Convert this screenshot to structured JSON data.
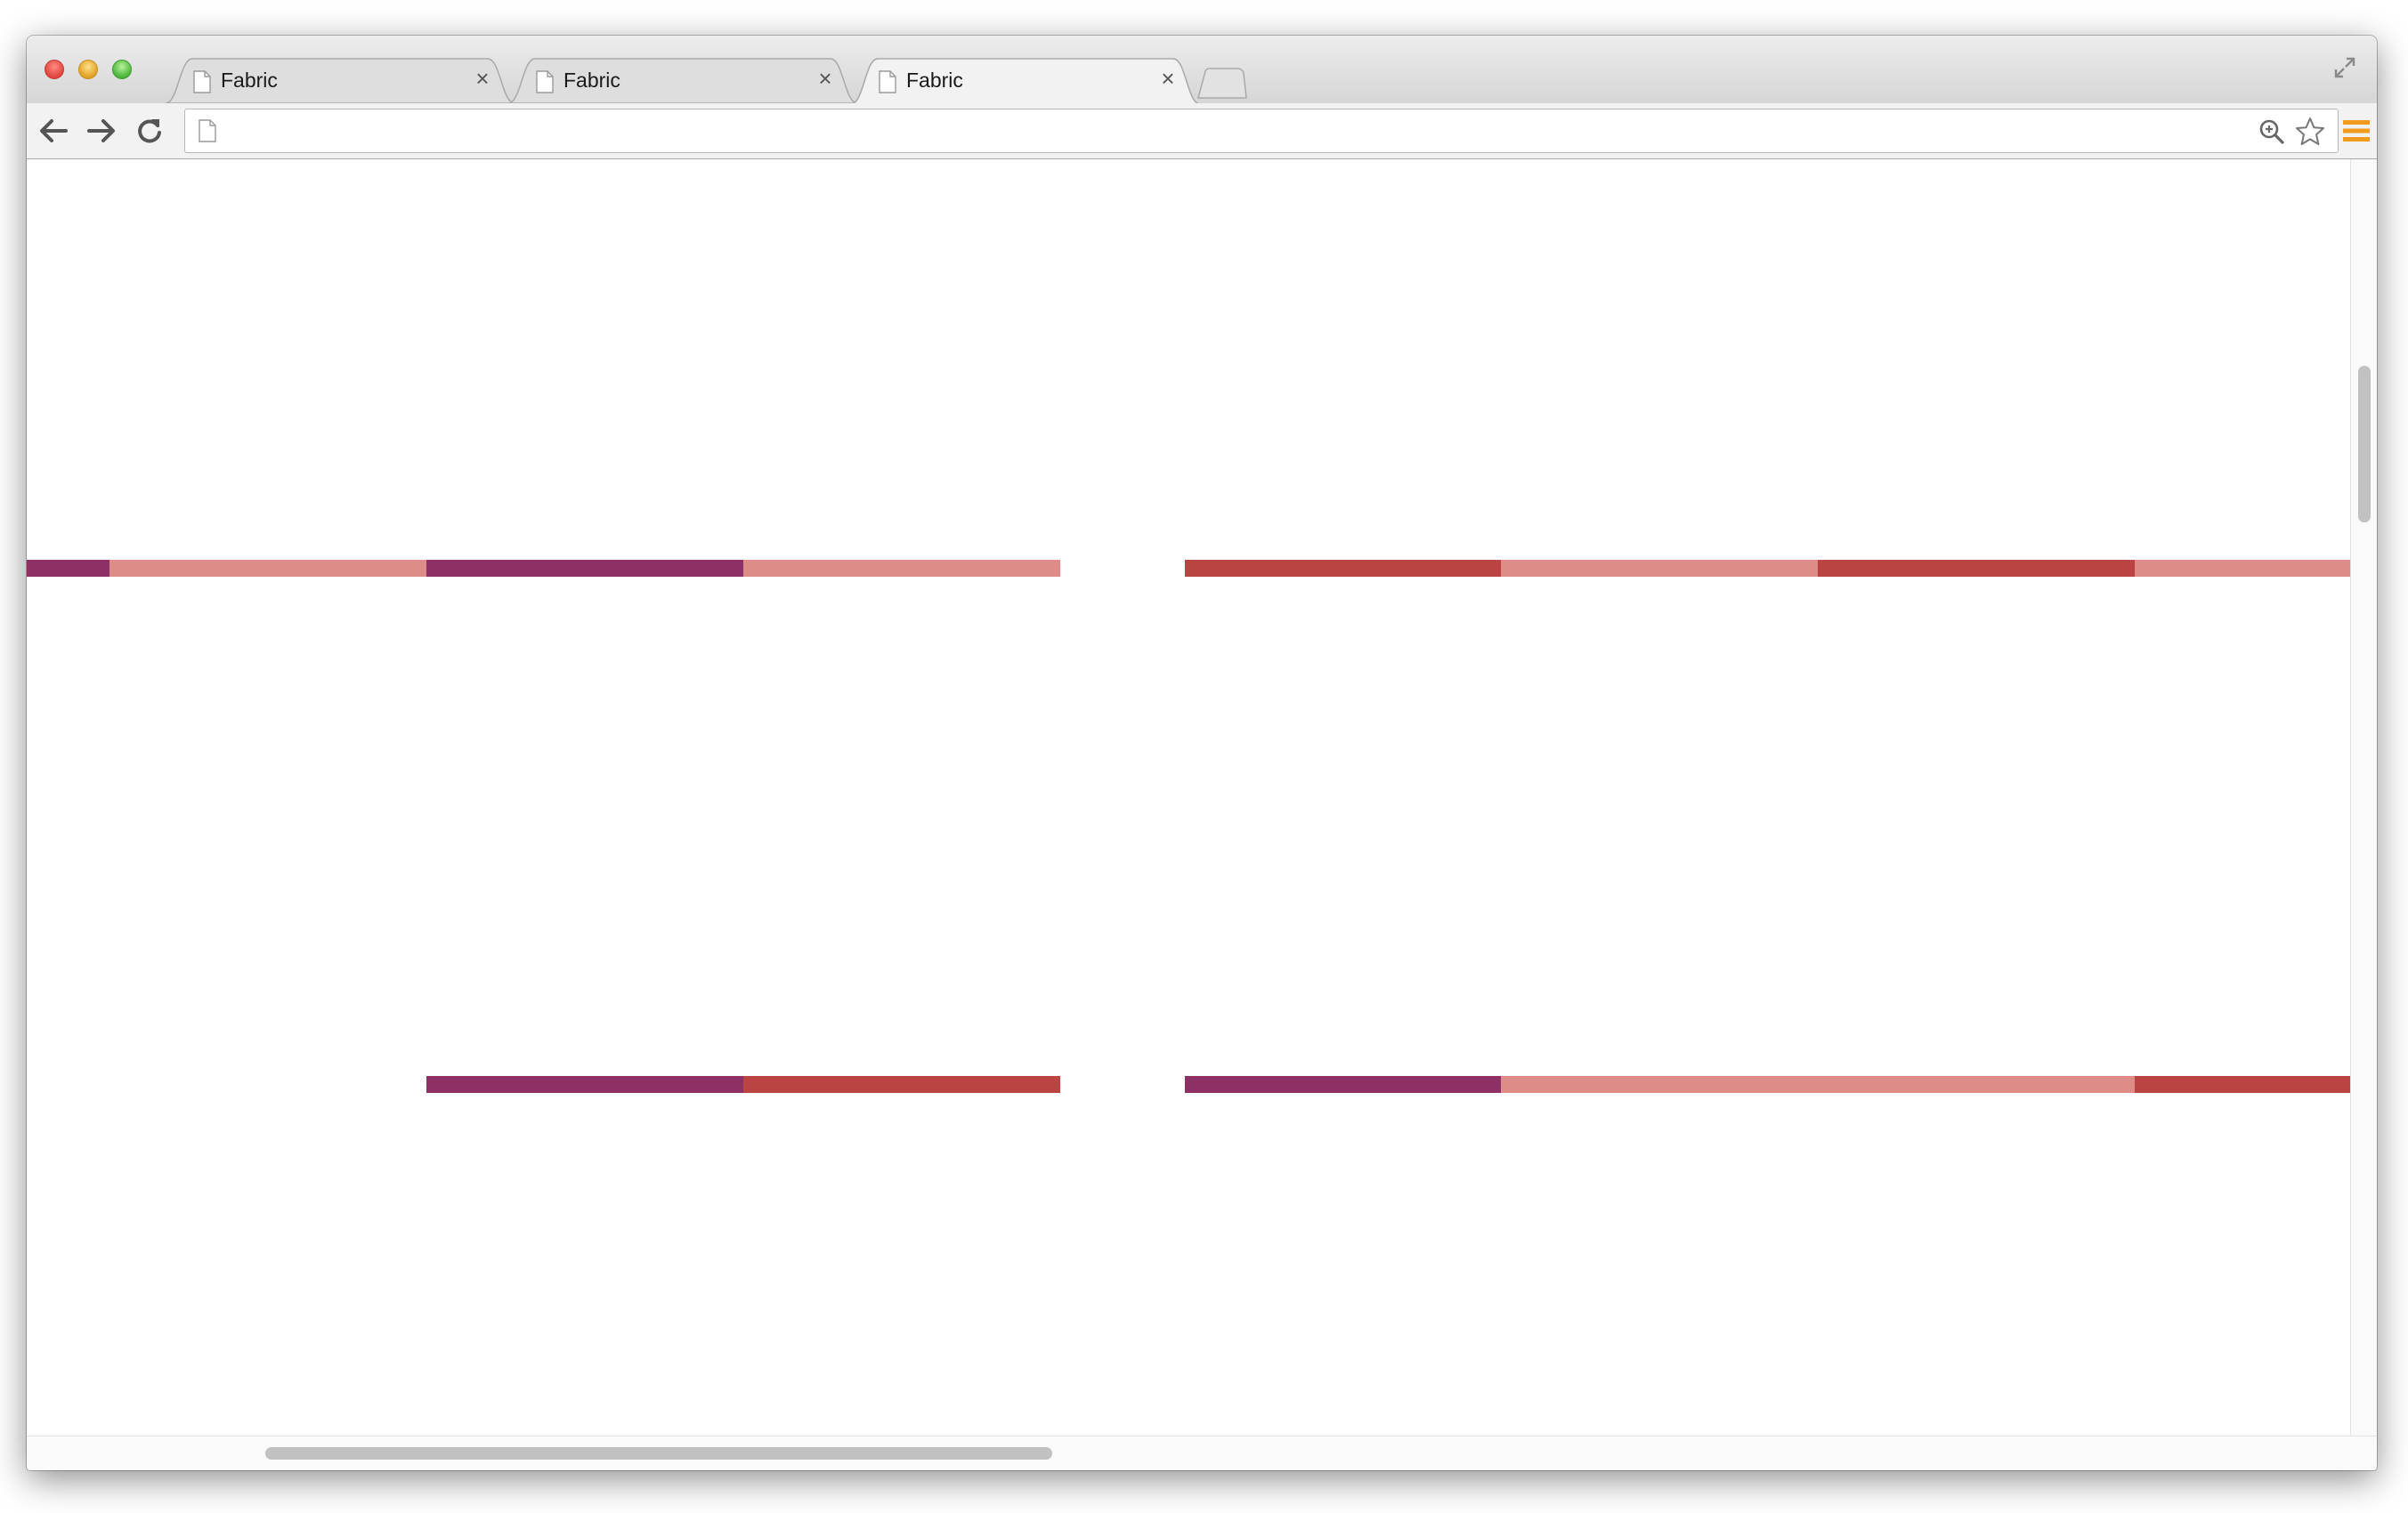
{
  "browser": {
    "tabs": [
      {
        "title": "Fabric",
        "active": false
      },
      {
        "title": "Fabric",
        "active": false
      },
      {
        "title": "Fabric",
        "active": true
      }
    ],
    "tab_close_glyph": "×",
    "address_bar": {
      "url": ""
    },
    "icons": {
      "back": "back-arrow-icon",
      "forward": "forward-arrow-icon",
      "reload": "reload-icon",
      "page": "blank-page-icon",
      "zoom": "zoom-icon",
      "bookmark": "star-icon",
      "menu": "hamburger-menu-icon",
      "fullscreen": "fullscreen-icon"
    }
  },
  "canvas": {
    "colors": {
      "purple": "#8c3066",
      "red": "#b94441",
      "pink": "#dd8c88"
    },
    "bars": [
      {
        "row": 1,
        "segments": [
          "purple",
          "pink",
          "purple",
          "pink",
          "red",
          "pink",
          "red",
          "pink"
        ]
      },
      {
        "row": 2,
        "segments": [
          "purple",
          "red",
          "purple",
          "pink",
          "red"
        ]
      }
    ]
  }
}
